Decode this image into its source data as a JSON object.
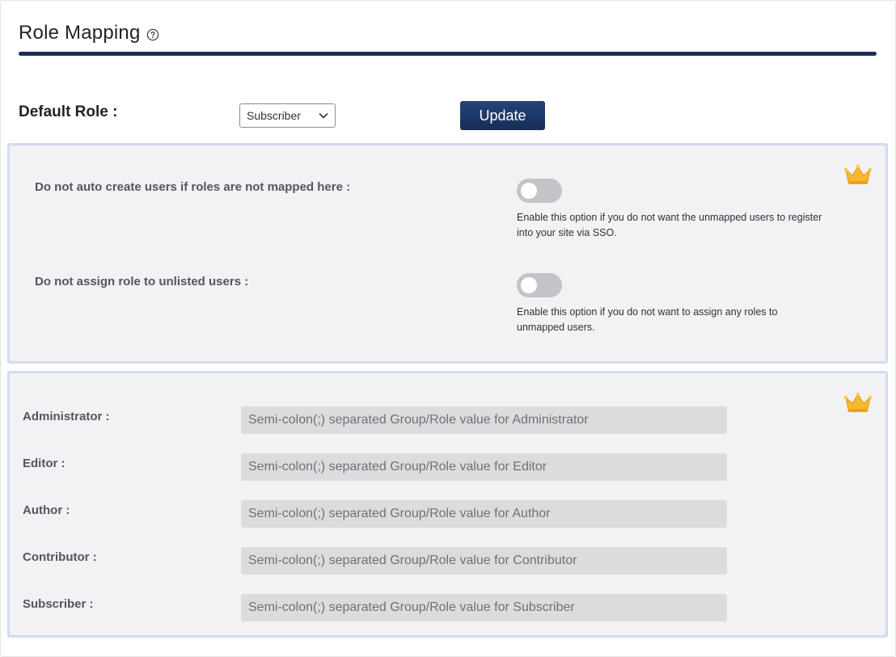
{
  "header": {
    "title": "Role Mapping",
    "help_icon": "question-circle-icon"
  },
  "default_role": {
    "label": "Default Role :",
    "selected": "Subscriber",
    "update_label": "Update"
  },
  "options_panel": {
    "crown_icon": "premium-crown-icon",
    "items": [
      {
        "label": "Do not auto create users if roles are not mapped here :",
        "enabled": false,
        "description": "Enable this option if you do not want the unmapped users to register into your site via SSO."
      },
      {
        "label": "Do not assign role to unlisted users :",
        "enabled": false,
        "description": "Enable this option if you do not want to assign any roles to unmapped users."
      }
    ]
  },
  "mapping_panel": {
    "crown_icon": "premium-crown-icon",
    "rows": [
      {
        "label": "Administrator :",
        "value": "",
        "placeholder": "Semi-colon(;) separated Group/Role value for Administrator"
      },
      {
        "label": "Editor :",
        "value": "",
        "placeholder": "Semi-colon(;) separated Group/Role value for Editor"
      },
      {
        "label": "Author :",
        "value": "",
        "placeholder": "Semi-colon(;) separated Group/Role value for Author"
      },
      {
        "label": "Contributor :",
        "value": "",
        "placeholder": "Semi-colon(;) separated Group/Role value for Contributor"
      },
      {
        "label": "Subscriber :",
        "value": "",
        "placeholder": "Semi-colon(;) separated Group/Role value for Subscriber"
      }
    ]
  },
  "colors": {
    "accent": "#1f2e54",
    "button": "#1e3766",
    "panel_bg": "#f2f2f4",
    "panel_border": "#cfdcf7",
    "toggle_off": "#c3c4c7",
    "input_bg": "#dcdcde",
    "crown": "#f5b82e"
  }
}
